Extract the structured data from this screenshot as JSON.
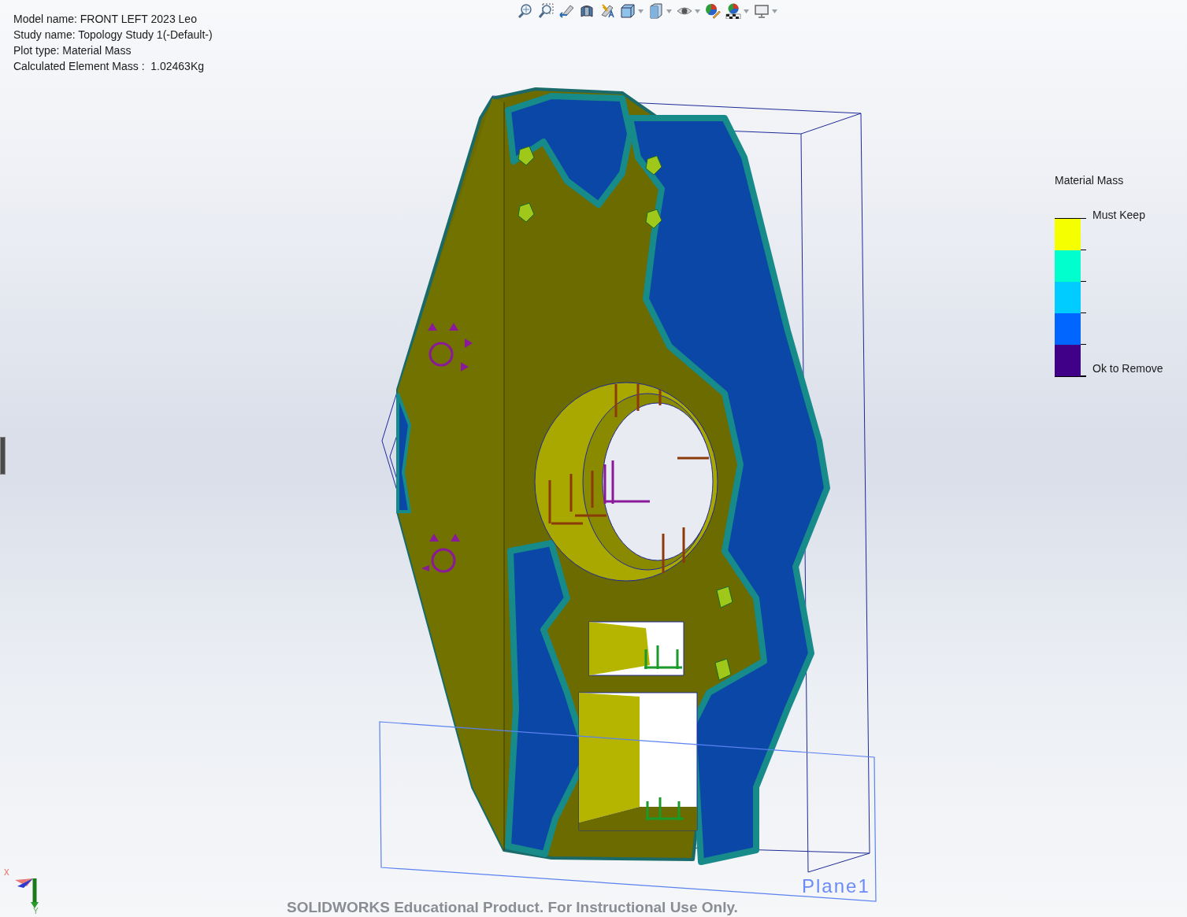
{
  "info": [
    "Model name: FRONT LEFT 2023 Leo",
    "Study name: Topology Study 1(-Default-)",
    "Plot type: Material Mass",
    "Calculated Element Mass :  1.02463Kg"
  ],
  "toolbar": [
    {
      "kind": "zoom-fit",
      "dropdown": false
    },
    {
      "kind": "zoom-area",
      "dropdown": false
    },
    {
      "kind": "previous-view",
      "dropdown": false
    },
    {
      "kind": "section-view",
      "dropdown": false
    },
    {
      "kind": "annotation-view",
      "dropdown": false
    },
    {
      "kind": "view-orientation",
      "dropdown": true
    },
    {
      "kind": "display-style",
      "dropdown": true
    },
    {
      "kind": "hide-show",
      "dropdown": true
    },
    {
      "kind": "edit-appearance",
      "dropdown": false
    },
    {
      "kind": "apply-scene",
      "dropdown": true
    },
    {
      "kind": "view-settings",
      "dropdown": true
    }
  ],
  "legend": {
    "title": "Material Mass",
    "top_label": "Must Keep",
    "bottom_label": "Ok to Remove",
    "bands": [
      {
        "color": "#f5ff00"
      },
      {
        "color": "#00ffcc"
      },
      {
        "color": "#00ccff"
      },
      {
        "color": "#0066ff"
      },
      {
        "color": "#400087"
      }
    ]
  },
  "plane_label": "Plane1",
  "triad": {
    "x_label": "X",
    "y_label": "Y"
  },
  "footer": "SOLIDWORKS Educational Product. For Instructional Use Only."
}
